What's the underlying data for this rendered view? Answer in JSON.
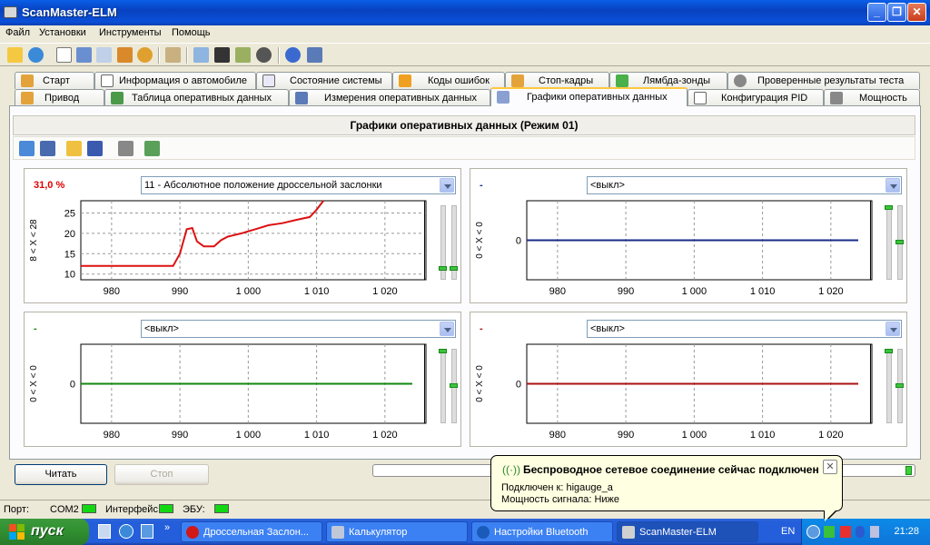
{
  "window": {
    "title": "ScanMaster-ELM"
  },
  "menu": [
    "Файл",
    "Установки",
    "Инструменты",
    "Помощь"
  ],
  "tabs_row1": [
    {
      "label": "Старт"
    },
    {
      "label": "Информация о автомобиле"
    },
    {
      "label": "Состояние системы"
    },
    {
      "label": "Коды ошибок"
    },
    {
      "label": "Стоп-кадры"
    },
    {
      "label": "Лямбда-зонды"
    },
    {
      "label": "Проверенные результаты теста"
    }
  ],
  "tabs_row2": [
    {
      "label": "Привод"
    },
    {
      "label": "Таблица оперативных данных"
    },
    {
      "label": "Измерения оперативных данных"
    },
    {
      "label": "Графики оперативных данных",
      "active": true
    },
    {
      "label": "Конфигурация PID"
    },
    {
      "label": "Мощность"
    }
  ],
  "panel": {
    "title": "Графики оперативных данных (Режим 01)"
  },
  "charts": [
    {
      "value": "31,0 %",
      "value_color": "#e00000",
      "select": "11 - Абсолютное положение дроссельной заслонки",
      "ylabel": "8 < X < 28",
      "yticks": [
        "25",
        "20",
        "15",
        "10"
      ],
      "xticks": [
        "980",
        "990",
        "1 000",
        "1 010",
        "1 020"
      ],
      "line_color": "#dd1111"
    },
    {
      "value": "-",
      "value_color": "#1a2b8a",
      "select": "<выкл>",
      "ylabel": "0 < X < 0",
      "yticks": [
        "0"
      ],
      "xticks": [
        "980",
        "990",
        "1 000",
        "1 010",
        "1 020"
      ],
      "line_color": "#1a2b8a"
    },
    {
      "value": "-",
      "value_color": "#118811",
      "select": "<выкл>",
      "ylabel": "0 < X < 0",
      "yticks": [
        "0"
      ],
      "xticks": [
        "980",
        "990",
        "1 000",
        "1 010",
        "1 020"
      ],
      "line_color": "#118811"
    },
    {
      "value": "-",
      "value_color": "#aa1111",
      "select": "<выкл>",
      "ylabel": "0 < X < 0",
      "yticks": [
        "0"
      ],
      "xticks": [
        "980",
        "990",
        "1 000",
        "1 010",
        "1 020"
      ],
      "line_color": "#aa1111"
    }
  ],
  "chart_data": [
    {
      "type": "line",
      "title": "",
      "xlabel": "",
      "ylabel": "8 < X < 28",
      "xlim": [
        975.5,
        1026
      ],
      "ylim": [
        8.6,
        28
      ],
      "series": [
        {
          "x": [
            975.5,
            989,
            990,
            991,
            991.8,
            992.5,
            993.5,
            995,
            996,
            997,
            999,
            1001,
            1003,
            1005,
            1007,
            1009,
            1010,
            1011
          ],
          "y": [
            12,
            12,
            15,
            21,
            21.3,
            18,
            16.8,
            16.8,
            18.3,
            19.2,
            20,
            21,
            22,
            22.5,
            23.3,
            24,
            25.8,
            28
          ]
        }
      ]
    },
    {
      "type": "line",
      "title": "",
      "ylabel": "0 < X < 0",
      "xlim": [
        975.5,
        1026
      ],
      "series": [
        {
          "x": [
            975.5,
            1024
          ],
          "y": [
            0,
            0
          ]
        }
      ]
    },
    {
      "type": "line",
      "title": "",
      "ylabel": "0 < X < 0",
      "xlim": [
        975.5,
        1026
      ],
      "series": [
        {
          "x": [
            975.5,
            1024
          ],
          "y": [
            0,
            0
          ]
        }
      ]
    },
    {
      "type": "line",
      "title": "",
      "ylabel": "0 < X < 0",
      "xlim": [
        975.5,
        1026
      ],
      "series": [
        {
          "x": [
            975.5,
            1024
          ],
          "y": [
            0,
            0
          ]
        }
      ]
    }
  ],
  "buttons": {
    "read": "Читать",
    "stop": "Стоп"
  },
  "status": {
    "port_label": "Порт:",
    "port_value": "COM2",
    "interface_label": "Интерфейс:",
    "ecu_label": "ЭБУ:"
  },
  "balloon": {
    "title": "Беспроводное сетевое соединение сейчас подключен",
    "line1": "Подключен к: higauge_a",
    "line2": "Мощность сигнала: Ниже"
  },
  "taskbar": {
    "start": "пуск",
    "tasks": [
      "Дроссельная Заслон...",
      "Калькулятор",
      "Настройки Bluetooth",
      "ScanMaster-ELM"
    ],
    "lang": "EN",
    "clock": "21:28"
  }
}
